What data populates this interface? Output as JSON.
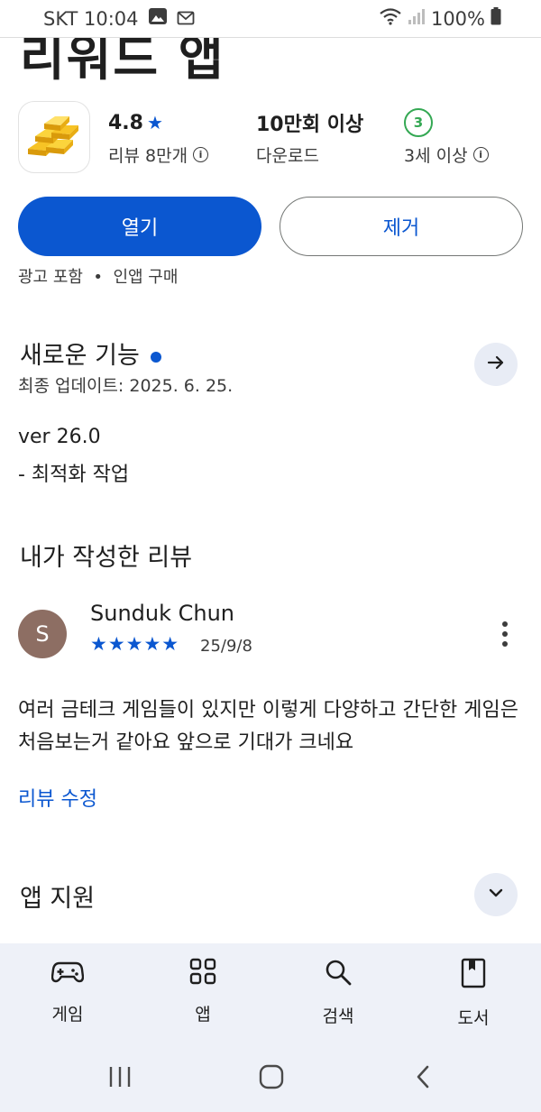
{
  "status_bar": {
    "carrier_time": "SKT 10:04",
    "battery": "100%"
  },
  "app": {
    "title": "리워드 앱",
    "rating": "4.8",
    "reviews_label": "리뷰 8만개",
    "downloads": "10만회 이상",
    "downloads_label": "다운로드",
    "age_badge": "3",
    "age_label": "3세 이상",
    "open_label": "열기",
    "remove_label": "제거",
    "notice": "광고 포함  •  인앱 구매"
  },
  "whats_new": {
    "title": "새로운 기능",
    "updated": "최종 업데이트: 2025. 6. 25.",
    "version": "ver 26.0",
    "note": "- 최적화 작업"
  },
  "my_review": {
    "title": "내가 작성한 리뷰",
    "avatar_letter": "S",
    "reviewer": "Sunduk Chun",
    "stars": "★★★★★",
    "rating_value": 5,
    "date": "25/9/8",
    "text": "여러 금테크 게임들이 있지만 이렇게 다양하고 간단한 게임은 처음보는거 같아요 앞으로 기대가 크네요",
    "edit_label": "리뷰 수정"
  },
  "app_support": {
    "title": "앱 지원"
  },
  "bottom_nav": {
    "items": [
      {
        "label": "게임",
        "icon": "gamepad-icon"
      },
      {
        "label": "앱",
        "icon": "apps-grid-icon"
      },
      {
        "label": "검색",
        "icon": "search-icon"
      },
      {
        "label": "도서",
        "icon": "book-icon"
      }
    ]
  },
  "colors": {
    "accent": "#0b57d0",
    "age_green": "#34a853",
    "avatar_bg": "#8d6e63",
    "nav_bg": "#eef1f8"
  }
}
